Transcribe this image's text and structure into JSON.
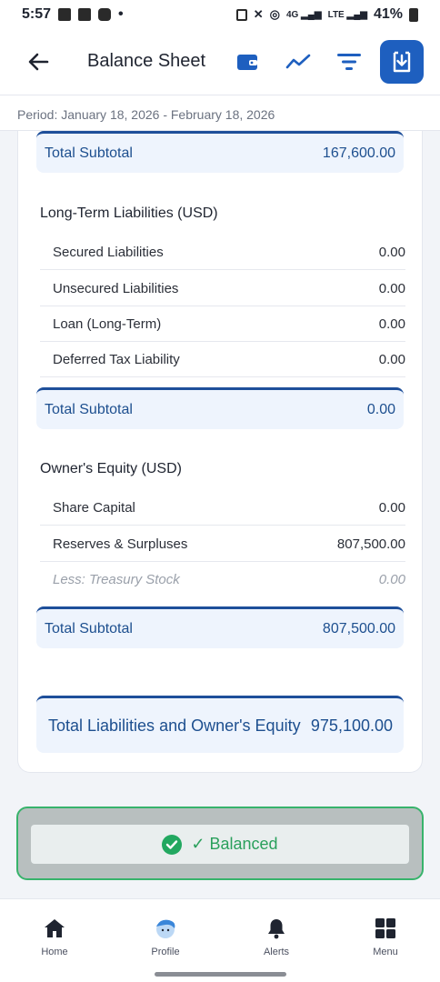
{
  "status_bar": {
    "time": "5:57",
    "battery": "41%"
  },
  "app_bar": {
    "title": "Balance Sheet"
  },
  "period": {
    "text": "Period: January 18, 2026 - February 18, 2026"
  },
  "current_liabilities_subtotal": {
    "label": "Total Subtotal",
    "value": "167,600.00"
  },
  "long_term_liabilities": {
    "title": "Long-Term Liabilities (USD)",
    "rows": [
      {
        "label": "Secured Liabilities",
        "value": "0.00"
      },
      {
        "label": "Unsecured Liabilities",
        "value": "0.00"
      },
      {
        "label": "Loan (Long-Term)",
        "value": "0.00"
      },
      {
        "label": "Deferred Tax Liability",
        "value": "0.00"
      }
    ],
    "subtotal": {
      "label": "Total Subtotal",
      "value": "0.00"
    }
  },
  "owners_equity": {
    "title": "Owner's Equity (USD)",
    "rows": [
      {
        "label": "Share Capital",
        "value": "0.00"
      },
      {
        "label": "Reserves & Surpluses",
        "value": "807,500.00"
      },
      {
        "label": "Less: Treasury Stock",
        "value": "0.00"
      }
    ],
    "subtotal": {
      "label": "Total Subtotal",
      "value": "807,500.00"
    }
  },
  "grand_total": {
    "label": "Total Liabilities and Owner's Equity",
    "value": "975,100.00"
  },
  "balance_status": {
    "label": "✓ Balanced"
  },
  "bottom_nav": {
    "home": "Home",
    "profile": "Profile",
    "alerts": "Alerts",
    "menu": "Menu"
  },
  "colors": {
    "primary": "#1e5fbf",
    "subtotal_text": "#1d4f8f",
    "balanced_green": "#2aa05c"
  }
}
